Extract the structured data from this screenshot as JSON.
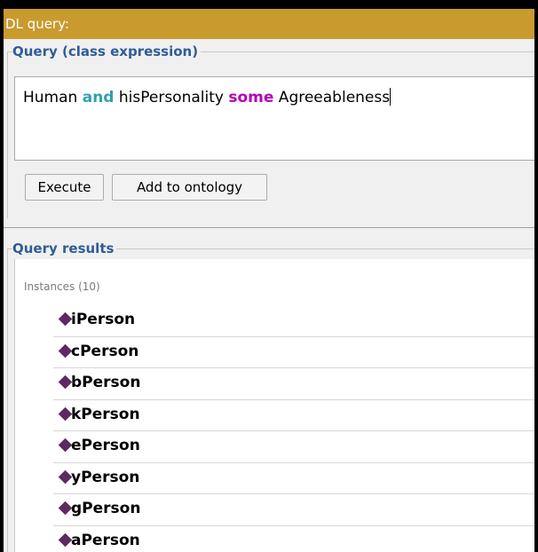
{
  "window": {
    "title": "DL query:"
  },
  "query": {
    "group_title": "Query (class expression)",
    "expression": {
      "part1": "Human ",
      "kw_and": "and",
      "part2": " hisPersonality ",
      "kw_some": "some",
      "part3": " Agreeableness"
    }
  },
  "buttons": {
    "execute": "Execute",
    "add_to_ontology": "Add to ontology"
  },
  "results": {
    "group_title": "Query results",
    "instances_label": "Instances (10)",
    "items": [
      {
        "label": "iPerson"
      },
      {
        "label": "cPerson"
      },
      {
        "label": "bPerson"
      },
      {
        "label": "kPerson"
      },
      {
        "label": "ePerson"
      },
      {
        "label": "yPerson"
      },
      {
        "label": "gPerson"
      },
      {
        "label": "aPerson"
      }
    ]
  },
  "colors": {
    "titlebar": "#c99a2e",
    "group_title": "#2f5d97",
    "keyword_and": "#32a0ad",
    "keyword_some": "#b400b4",
    "individual_icon": "#5e2a5e"
  }
}
